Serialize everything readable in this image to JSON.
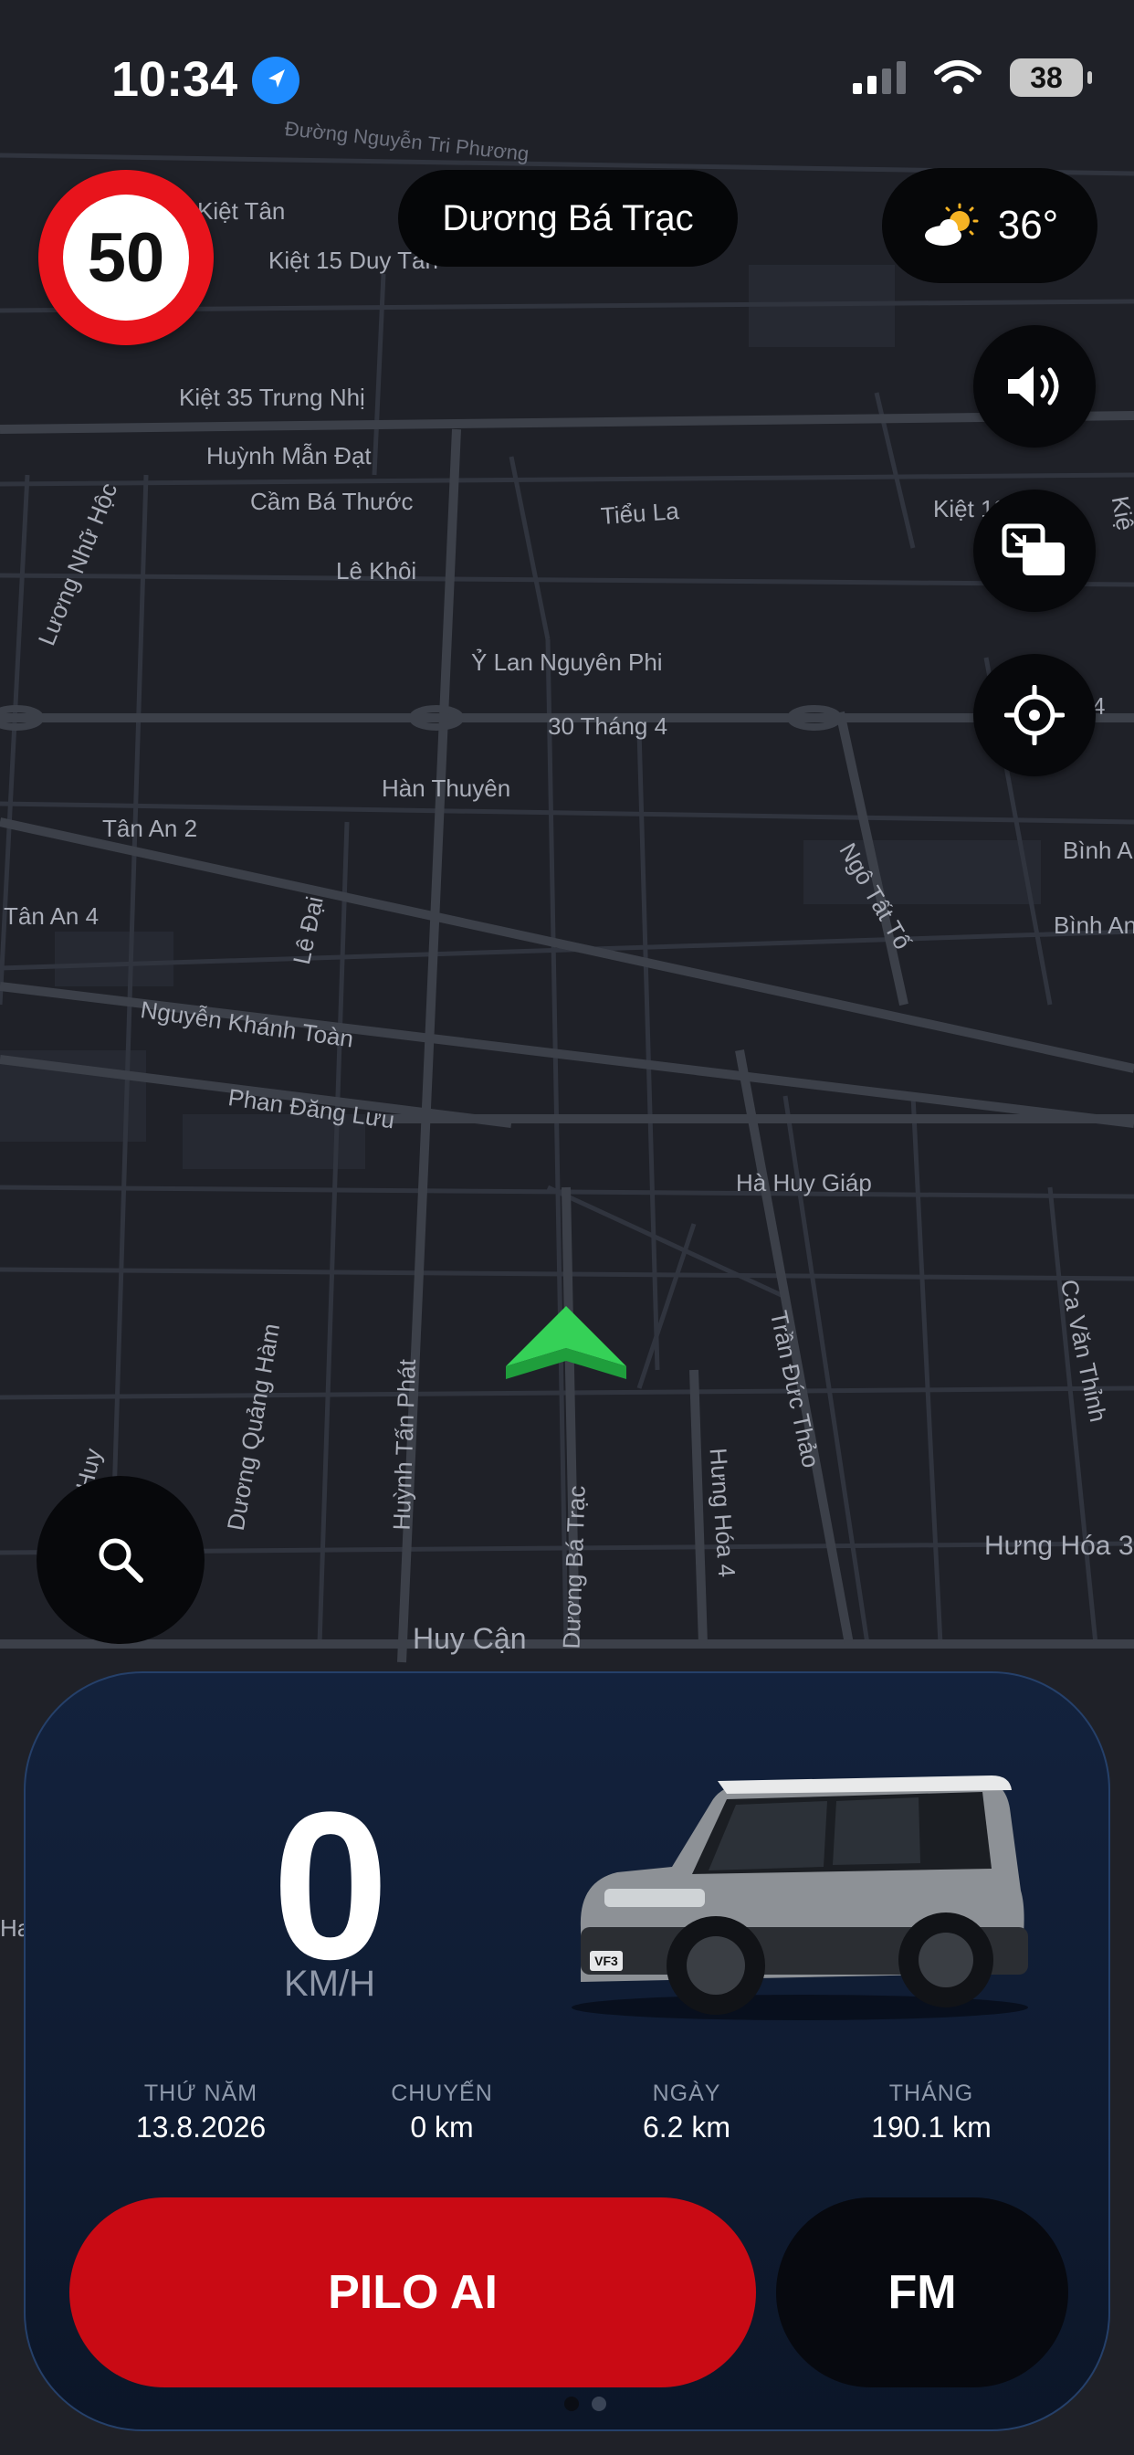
{
  "status_bar": {
    "time": "10:34",
    "battery": "38"
  },
  "speed_limit": "50",
  "current_street": "Dương Bá Trạc",
  "weather": {
    "temperature": "36°",
    "icon": "partly-sunny-icon"
  },
  "map": {
    "labels": [
      "Đường Nguyễn Tri Phương",
      "Kiệt Tân",
      "Kiệt 15 Duy Tân",
      "Kiệt 35 Trưng Nhị",
      "Huỳnh Mẫn Đạt",
      "Cầm Bá Thước",
      "Tiểu La",
      "Kiệt 12",
      "Lê Khôi",
      "Lương Nhữ Hộc",
      "Ỷ Lan Nguyên Phi",
      "30 Tháng 4",
      "Hàn Thuyên",
      "Tân An 2",
      "Tân An 4",
      "Lê Đại",
      "Ngô Tất Tố",
      "Bình A",
      "Bình An",
      "Nguyễn Khánh Toàn",
      "Phan Đăng Lưu",
      "Hà Huy Giáp",
      "Dương Quảng Hàm",
      "Huỳnh Tấn Phát",
      "Dương Bá Trạc",
      "Hưng Hóa 4",
      "Trần Đức Thảo",
      "Ca Văn Thỉnh",
      "Hưng Hóa 3",
      "Huy Cận",
      "Huy",
      "Ha",
      "Kiệ",
      "4"
    ]
  },
  "controls": {
    "sound_icon": "speaker-icon",
    "screen_icon": "screen-mirror-icon",
    "locate_icon": "crosshair-icon",
    "search_icon": "search-icon"
  },
  "dashboard": {
    "speed": "0",
    "speed_unit": "KM/H",
    "stats": [
      {
        "label": "THỨ NĂM",
        "value": "13.8.2026"
      },
      {
        "label": "CHUYẾN",
        "value": "0 km"
      },
      {
        "label": "NGÀY",
        "value": "6.2 km"
      },
      {
        "label": "THÁNG",
        "value": "190.1 km"
      }
    ],
    "car_plate_badge": "VF3",
    "primary_button": "PILO AI",
    "secondary_button": "FM",
    "page_indicator": {
      "pages": 2,
      "current": 1
    }
  },
  "colors": {
    "accent_red": "#c90a14",
    "nav_green": "#2fc84f",
    "panel_bg": "#13223d"
  }
}
